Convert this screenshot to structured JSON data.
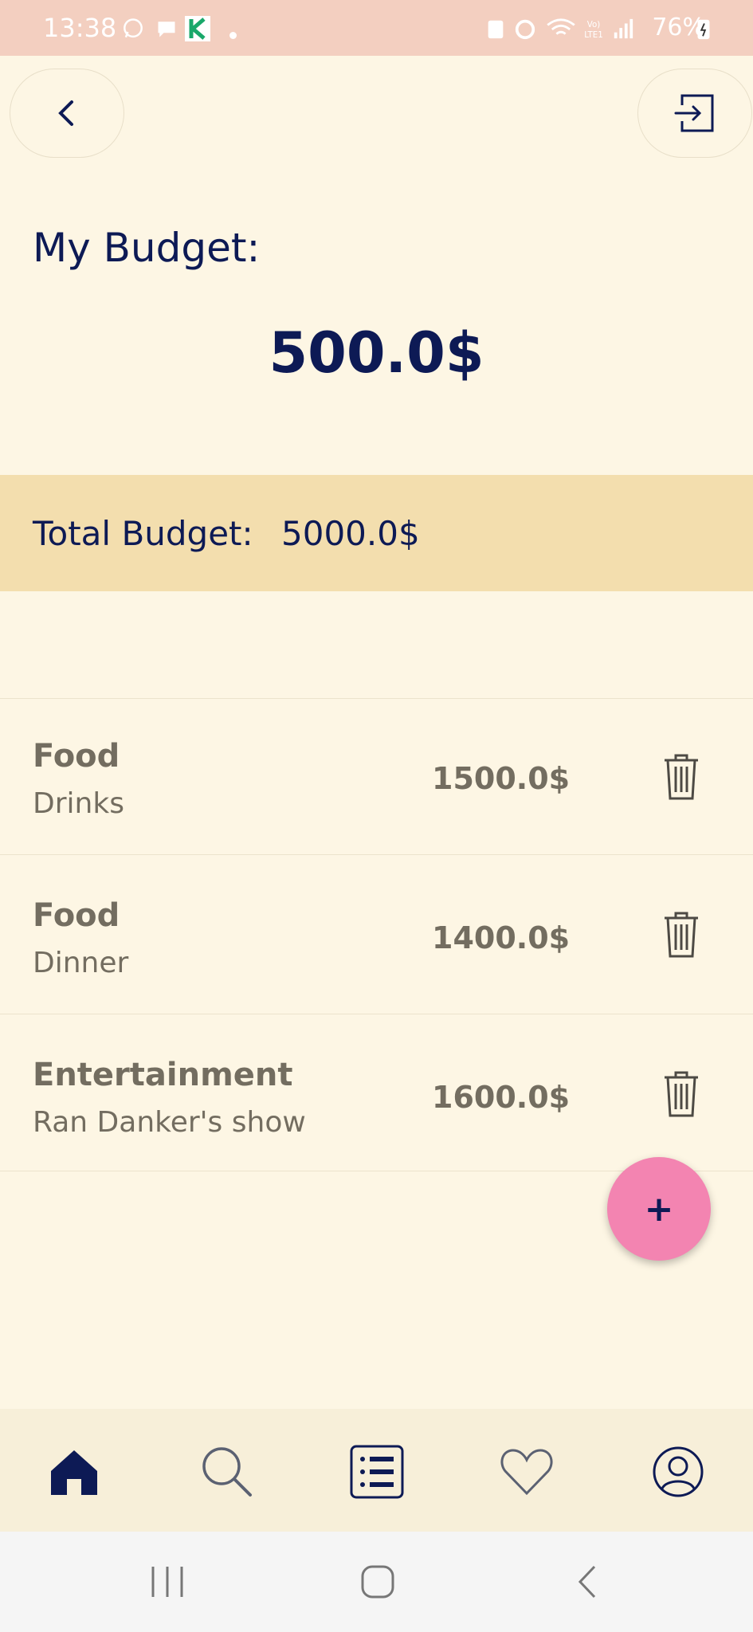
{
  "status_bar": {
    "time": "13:38",
    "battery": "76%"
  },
  "header": {
    "back_icon": "chevron-left-icon",
    "logout_icon": "logout-icon"
  },
  "budget": {
    "title": "My Budget:",
    "amount": "500.0$",
    "total_label": "Total Budget:",
    "total_value": "5000.0$"
  },
  "expenses": [
    {
      "category": "Food",
      "description": "Drinks",
      "amount": "1500.0$"
    },
    {
      "category": "Food",
      "description": "Dinner",
      "amount": "1400.0$"
    },
    {
      "category": "Entertainment",
      "description": "Ran Danker's show",
      "amount": "1600.0$"
    }
  ],
  "fab": {
    "label": "+"
  },
  "bottom_nav": [
    "home-icon",
    "search-icon",
    "list-icon",
    "heart-icon",
    "profile-icon"
  ],
  "colors": {
    "accent": "#0d1a55",
    "fab": "#f384b1",
    "band": "#f3deae",
    "background": "#fdf6e4"
  }
}
